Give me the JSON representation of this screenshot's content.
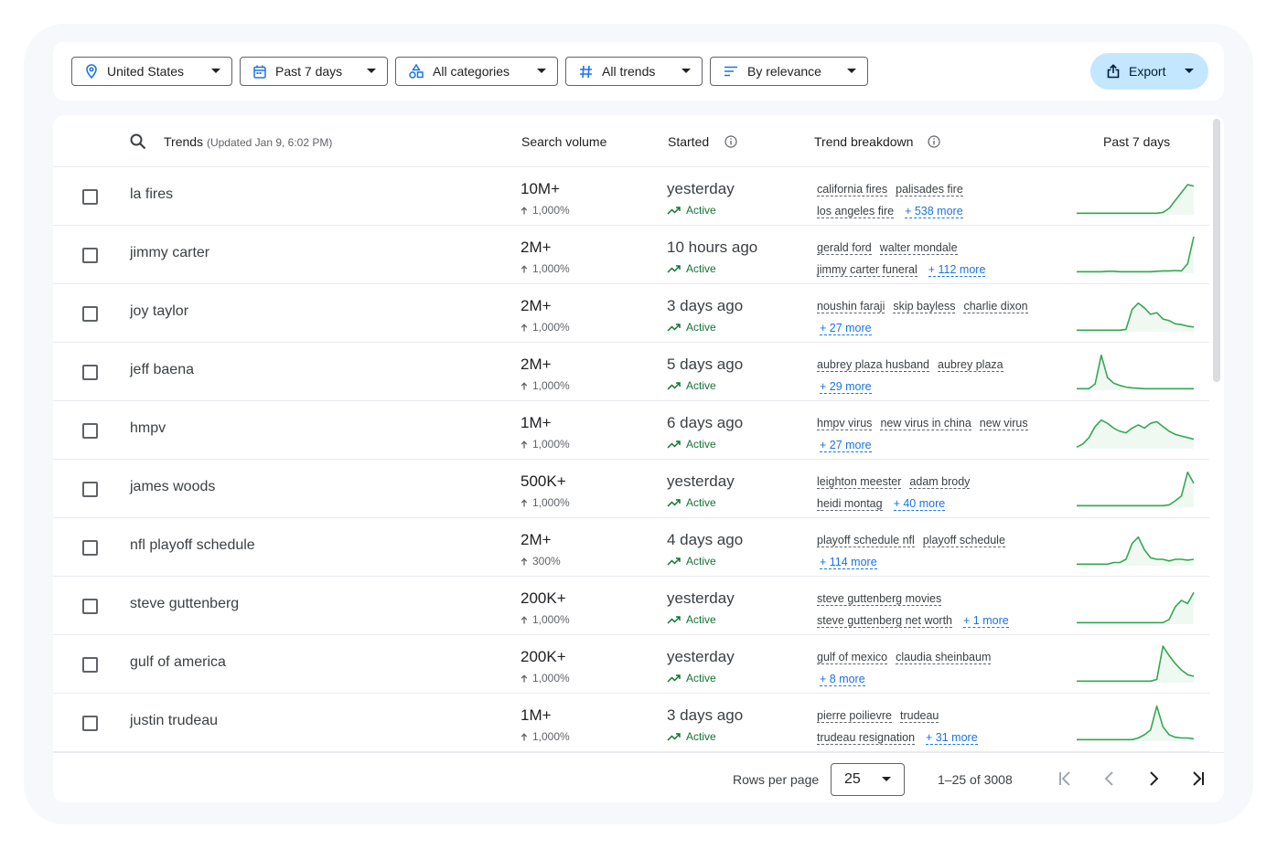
{
  "filters": {
    "location": "United States",
    "time": "Past 7 days",
    "category": "All categories",
    "trend_type": "All trends",
    "sort": "By relevance",
    "export_label": "Export"
  },
  "table": {
    "headers": {
      "trends": "Trends",
      "updated": "(Updated Jan 9, 6:02 PM)",
      "search_volume": "Search volume",
      "started": "Started",
      "breakdown": "Trend breakdown",
      "past": "Past 7 days"
    },
    "rows": [
      {
        "title": "la fires",
        "volume": "10M+",
        "pct": "1,000%",
        "started": "yesterday",
        "status": "Active",
        "line1": [
          "california fires",
          "palisades fire"
        ],
        "line2": [
          "los angeles fire"
        ],
        "more": "+ 538 more",
        "spark": [
          2,
          2,
          2,
          2,
          2,
          2,
          2,
          2,
          2,
          2,
          2,
          2,
          2,
          2,
          3,
          8,
          18,
          28,
          38,
          36
        ]
      },
      {
        "title": "jimmy carter",
        "volume": "2M+",
        "pct": "1,000%",
        "started": "10 hours ago",
        "status": "Active",
        "line1": [
          "gerald ford",
          "walter mondale"
        ],
        "line2": [
          "jimmy carter funeral"
        ],
        "more": "+ 112 more",
        "spark": [
          2,
          2,
          2,
          2,
          2,
          2.5,
          2.5,
          2,
          2,
          2,
          2,
          2,
          2,
          2.5,
          3,
          3,
          3.5,
          3,
          12,
          46
        ]
      },
      {
        "title": "joy taylor",
        "volume": "2M+",
        "pct": "1,000%",
        "started": "3 days ago",
        "status": "Active",
        "line1": [
          "noushin faraji",
          "skip bayless",
          "charlie dixon"
        ],
        "line2": [],
        "more": "+ 27 more",
        "spark": [
          2,
          2,
          2,
          2,
          2,
          2,
          2,
          2,
          3,
          28,
          36,
          30,
          22,
          24,
          16,
          14,
          10,
          9,
          7,
          6
        ]
      },
      {
        "title": "jeff baena",
        "volume": "2M+",
        "pct": "1,000%",
        "started": "5 days ago",
        "status": "Active",
        "line1": [
          "aubrey plaza husband",
          "aubrey plaza"
        ],
        "line2": [],
        "more": "+ 29 more",
        "spark": [
          2,
          2,
          2,
          8,
          44,
          16,
          9,
          6,
          4,
          3,
          2.5,
          2,
          2,
          2,
          2,
          2,
          2,
          2,
          2,
          2
        ]
      },
      {
        "title": "hmpv",
        "volume": "1M+",
        "pct": "1,000%",
        "started": "6 days ago",
        "status": "Active",
        "line1": [
          "hmpv virus",
          "new virus in china",
          "new virus"
        ],
        "line2": [],
        "more": "+ 27 more",
        "spark": [
          2,
          6,
          14,
          28,
          36,
          32,
          26,
          22,
          20,
          26,
          30,
          26,
          32,
          34,
          28,
          22,
          18,
          16,
          14,
          12
        ]
      },
      {
        "title": "james woods",
        "volume": "500K+",
        "pct": "1,000%",
        "started": "yesterday",
        "status": "Active",
        "line1": [
          "leighton meester",
          "adam brody"
        ],
        "line2": [
          "heidi montag"
        ],
        "more": "+ 40 more",
        "spark": [
          2,
          2,
          2,
          2,
          2,
          2,
          2,
          2,
          2,
          2,
          2,
          2,
          2,
          2,
          2,
          3,
          8,
          14,
          44,
          30
        ]
      },
      {
        "title": "nfl playoff schedule",
        "volume": "2M+",
        "pct": "300%",
        "started": "4 days ago",
        "status": "Active",
        "line1": [
          "playoff schedule nfl",
          "playoff schedule"
        ],
        "line2": [],
        "more": "+ 114 more",
        "spark": [
          2,
          2,
          2,
          2,
          2,
          2,
          4,
          4,
          8,
          28,
          36,
          20,
          10,
          8,
          8,
          6,
          8,
          8,
          7,
          8
        ]
      },
      {
        "title": "steve guttenberg",
        "volume": "200K+",
        "pct": "1,000%",
        "started": "yesterday",
        "status": "Active",
        "line1": [
          "steve guttenberg movies"
        ],
        "line2": [
          "steve guttenberg net worth"
        ],
        "more": "+ 1 more",
        "spark": [
          2,
          2,
          2,
          2,
          2,
          2,
          2,
          2,
          2,
          2,
          2,
          2,
          2,
          2,
          2,
          6,
          22,
          30,
          26,
          40
        ]
      },
      {
        "title": "gulf of america",
        "volume": "200K+",
        "pct": "1,000%",
        "started": "yesterday",
        "status": "Active",
        "line1": [
          "gulf of mexico",
          "claudia sheinbaum"
        ],
        "line2": [],
        "more": "+ 8 more",
        "spark": [
          2,
          2,
          2,
          2,
          2,
          2,
          2,
          2,
          2,
          2,
          2,
          2,
          2,
          4,
          46,
          34,
          24,
          16,
          10,
          8
        ]
      },
      {
        "title": "justin trudeau",
        "volume": "1M+",
        "pct": "1,000%",
        "started": "3 days ago",
        "status": "Active",
        "line1": [
          "pierre poilievre",
          "trudeau"
        ],
        "line2": [
          "trudeau resignation"
        ],
        "more": "+ 31 more",
        "spark": [
          2,
          2,
          2,
          2,
          2,
          2,
          2,
          2,
          2,
          2,
          4,
          8,
          14,
          44,
          18,
          8,
          5,
          4,
          4,
          3
        ]
      }
    ]
  },
  "colors": {
    "spark_line": "#34a853",
    "spark_fill": "#e6f4ea",
    "active": "#137333",
    "link": "#1a73e8"
  },
  "pagination": {
    "rows_per_page_label": "Rows per page",
    "rows_per_page": "25",
    "range": "1–25 of 3008"
  }
}
